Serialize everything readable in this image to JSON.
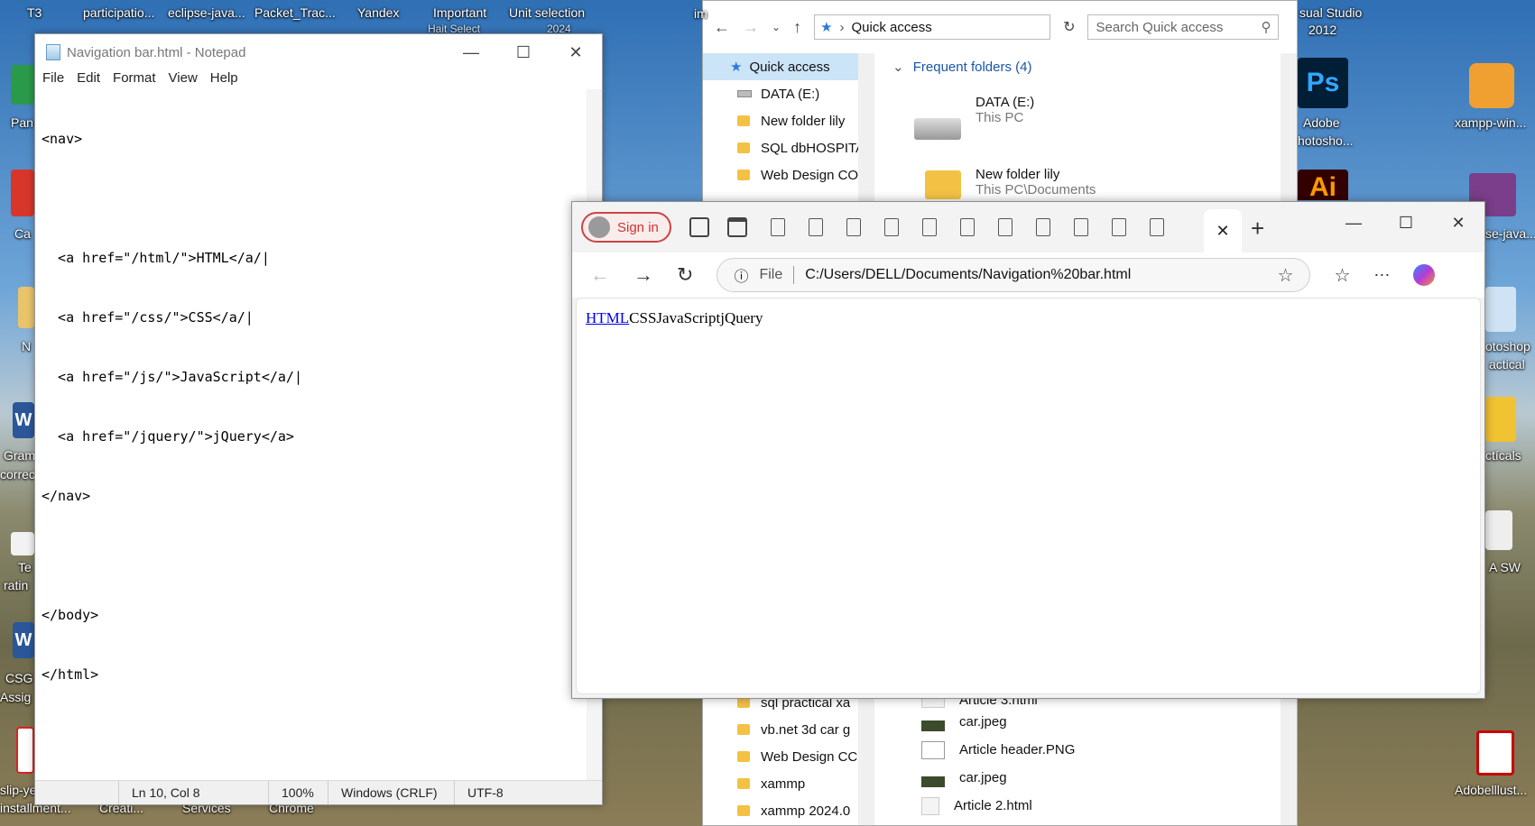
{
  "desktop": {
    "top_labels": [
      "T3",
      "participatio...",
      "eclipse-java...",
      "Packet_Trac...",
      "Yandex",
      "Important",
      "Unit selection"
    ],
    "partial_under_labels": [
      "Hait Select",
      "2024"
    ],
    "left_labels": [
      "Pan",
      "Ca",
      "N",
      "Gram",
      "correc",
      "Te",
      "ratin",
      "CSG",
      "Assig",
      "slip-ye",
      "installment..."
    ],
    "bottom_labels": [
      "Creati...",
      "Services",
      "Chrome"
    ],
    "right_labels": [
      "sual Studio",
      "2012",
      "Adobe",
      "hotosho...",
      "xampp-win...",
      "se-java...",
      "otoshop",
      "actical",
      "ctícals",
      "A SW",
      "Adobelllust..."
    ],
    "right_icons": [
      "Ps",
      "Ai"
    ],
    "word_icon": "W"
  },
  "notepad": {
    "title": "Navigation bar.html - Notepad",
    "menu": [
      "File",
      "Edit",
      "Format",
      "View",
      "Help"
    ],
    "lines": [
      "<nav>",
      "",
      "  <a href=\"/html/\">HTML</a/|",
      "  <a href=\"/css/\">CSS</a/|",
      "  <a href=\"/js/\">JavaScript</a/|",
      "  <a href=\"/jquery/\">jQuery</a>",
      "</nav>",
      "",
      "</body>",
      "</html>"
    ],
    "status": {
      "position": "Ln 10, Col 8",
      "zoom": "100%",
      "line_ending": "Windows (CRLF)",
      "encoding": "UTF-8"
    }
  },
  "explorer": {
    "partial_title": "im",
    "address": "Quick access",
    "search_placeholder": "Search Quick access",
    "sidebar": [
      {
        "label": "Quick access",
        "selected": true
      },
      {
        "label": "DATA (E:)"
      },
      {
        "label": "New folder lily"
      },
      {
        "label": "SQL dbHOSPITA"
      },
      {
        "label": "Web Design CO"
      },
      {
        "label": "sql practical xa"
      },
      {
        "label": "vb.net 3d car g"
      },
      {
        "label": "Web Design CC"
      },
      {
        "label": "xammp"
      },
      {
        "label": "xammp 2024.0"
      }
    ],
    "section_header": "Frequent folders (4)",
    "tiles": [
      {
        "name": "DATA (E:)",
        "sub": "This PC"
      },
      {
        "name": "New folder lily",
        "sub": "This PC\\Documents"
      }
    ],
    "files": [
      "Article 3.html",
      "car.jpeg",
      "Article header.PNG",
      "car.jpeg",
      "Article 2.html"
    ]
  },
  "edge": {
    "signin_label": "Sign in",
    "url_scheme": "File",
    "url": "C:/Users/DELL/Documents/Navigation%20bar.html",
    "page": {
      "link": "HTML",
      "rest": "CSSJavaScriptjQuery"
    }
  }
}
